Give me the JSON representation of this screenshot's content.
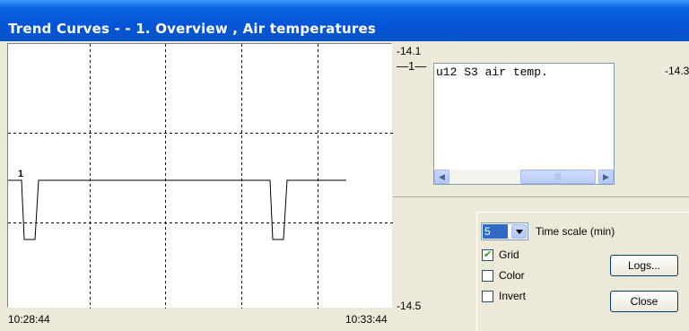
{
  "window": {
    "title": "Trend Curves -  - 1. Overview , Air temperatures"
  },
  "plot": {
    "time_start": "10:28:44",
    "time_end": "10:33:44",
    "curve_marker": "1",
    "y_top": "-14.1",
    "y_bottom": "-14.5",
    "grid": true
  },
  "legend": {
    "marker": "—1—",
    "text": "u12 S3 air temp.",
    "value": "-14.3"
  },
  "controls": {
    "time_scale_value": "5",
    "time_scale_label": "Time scale (min)",
    "grid_label": "Grid",
    "color_label": "Color",
    "invert_label": "Invert",
    "grid_checked": true,
    "color_checked": false,
    "invert_checked": false,
    "logs_button": "Logs...",
    "close_button": "Close"
  },
  "icons": {
    "scroll_left": "chevron-left-icon",
    "scroll_right": "chevron-right-icon",
    "dropdown": "chevron-down-icon"
  },
  "colors": {
    "titlebar": "#0454d8",
    "plot_bg": "#ffffff",
    "curve": "#000000",
    "dialog_bg": "#ece9d8"
  }
}
